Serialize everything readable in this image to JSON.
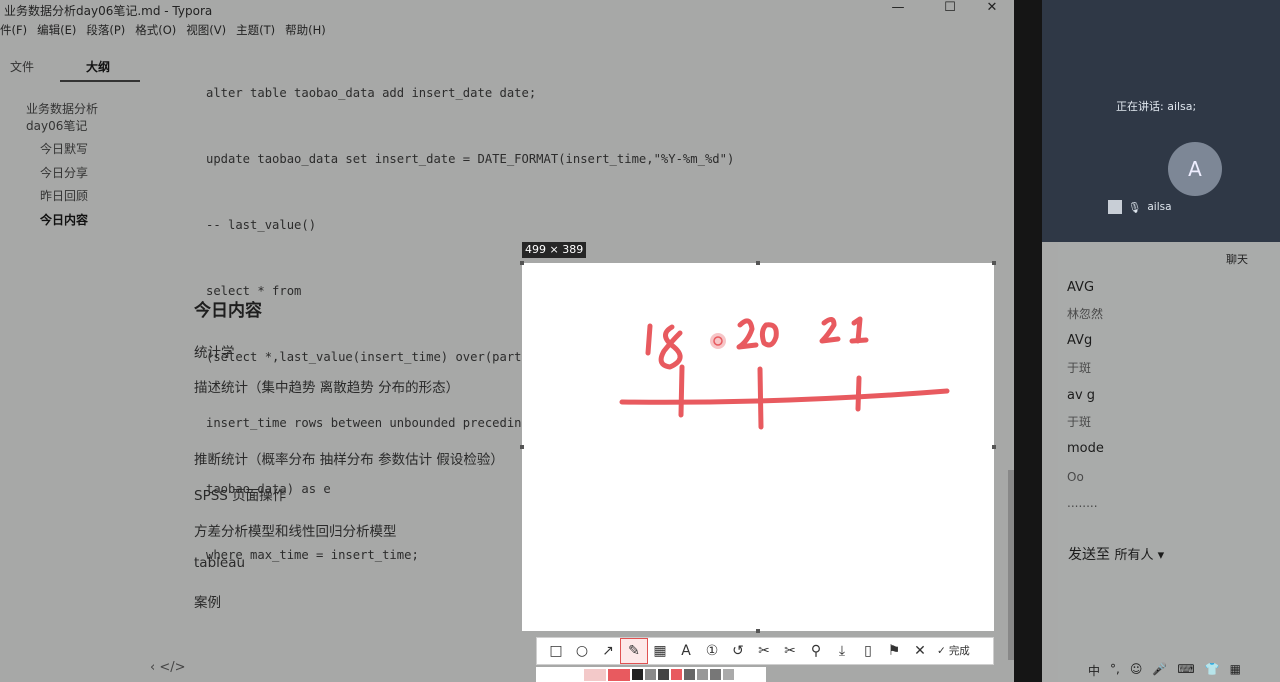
{
  "window": {
    "title": "业务数据分析day06笔记.md - Typora",
    "controls": [
      "—",
      "☐",
      "✕"
    ]
  },
  "menu": [
    "件(F)",
    "编辑(E)",
    "段落(P)",
    "格式(O)",
    "视图(V)",
    "主题(T)",
    "帮助(H)"
  ],
  "sidebar": {
    "tabs": [
      "文件",
      "大纲"
    ],
    "outline": [
      "业务数据分析",
      "day06笔记",
      "今日默写",
      "今日分享",
      "昨日回顾",
      "今日内容"
    ]
  },
  "code_lines": [
    "alter table taobao_data add insert_date date;",
    "update taobao_data set insert_date = DATE_FORMAT(insert_time,\"%Y-%m_%d\")",
    "-- last_value()",
    "select * from",
    "(select *,last_value(insert_time) over(partition by item_id,insert_date order by",
    "insert_time rows between unbounded preceding and unbounded following) as max_time from",
    "taobao_data) as e",
    "where max_time = insert_time;"
  ],
  "document": {
    "heading": "今日内容",
    "paragraphs": [
      "统计学",
      "描述统计（集中趋势 离散趋势 分布的形态）",
      "推断统计（概率分布 抽样分布 参数估计 假设检验）",
      "SPSS 页面操作",
      "方差分析模型和线性回归分析模型",
      "tableau",
      "案例"
    ]
  },
  "bottom_nav": "‹  </>",
  "capture": {
    "size_label": "499 × 389",
    "drawing": {
      "numbers": [
        "18",
        "20",
        "21"
      ],
      "stroke_color": "#e85a5f"
    }
  },
  "capture_toolbar": {
    "tools": [
      {
        "name": "rectangle-tool-icon",
        "glyph": "□"
      },
      {
        "name": "ellipse-tool-icon",
        "glyph": "○"
      },
      {
        "name": "arrow-tool-icon",
        "glyph": "↗"
      },
      {
        "name": "pen-tool-icon",
        "glyph": "✎",
        "active": true
      },
      {
        "name": "mosaic-tool-icon",
        "glyph": "▦"
      },
      {
        "name": "text-tool-icon",
        "glyph": "A"
      },
      {
        "name": "number-tool-icon",
        "glyph": "①"
      },
      {
        "name": "undo-icon",
        "glyph": "↺"
      },
      {
        "name": "cut-icon",
        "glyph": "✂"
      },
      {
        "name": "scissors-icon",
        "glyph": "✂"
      },
      {
        "name": "pin-icon",
        "glyph": "⚲"
      },
      {
        "name": "download-icon",
        "glyph": "⤓"
      },
      {
        "name": "phone-icon",
        "glyph": "▯"
      },
      {
        "name": "bookmark-icon",
        "glyph": "⚑"
      },
      {
        "name": "close-icon",
        "glyph": "✕"
      }
    ],
    "done_label": "完成",
    "palette_colors": [
      "#f3c9c9",
      "#e85a5f",
      "#222222",
      "#8a8a8a",
      "#444444",
      "#e85a5f",
      "#666666",
      "#999999",
      "#777777",
      "#aaaaaa"
    ]
  },
  "meeting": {
    "speaking": "正在讲话: ailsa;",
    "avatar_letter": "A",
    "participant": "ailsa",
    "chat_title": "聊天",
    "messages": [
      {
        "text": "AVG",
        "sender": "林忽然"
      },
      {
        "text": "AVg",
        "sender": "于斑"
      },
      {
        "text": "av g",
        "sender": "于斑"
      },
      {
        "text": "mode",
        "sender": "Oo"
      }
    ],
    "ellipsis": "........",
    "send_to_label": "发送至",
    "send_to_value": "所有人 ▾"
  },
  "taskbar": {
    "items": [
      "中",
      "°,",
      "☺",
      "🎤",
      "⌨",
      "👕",
      "▦"
    ]
  }
}
